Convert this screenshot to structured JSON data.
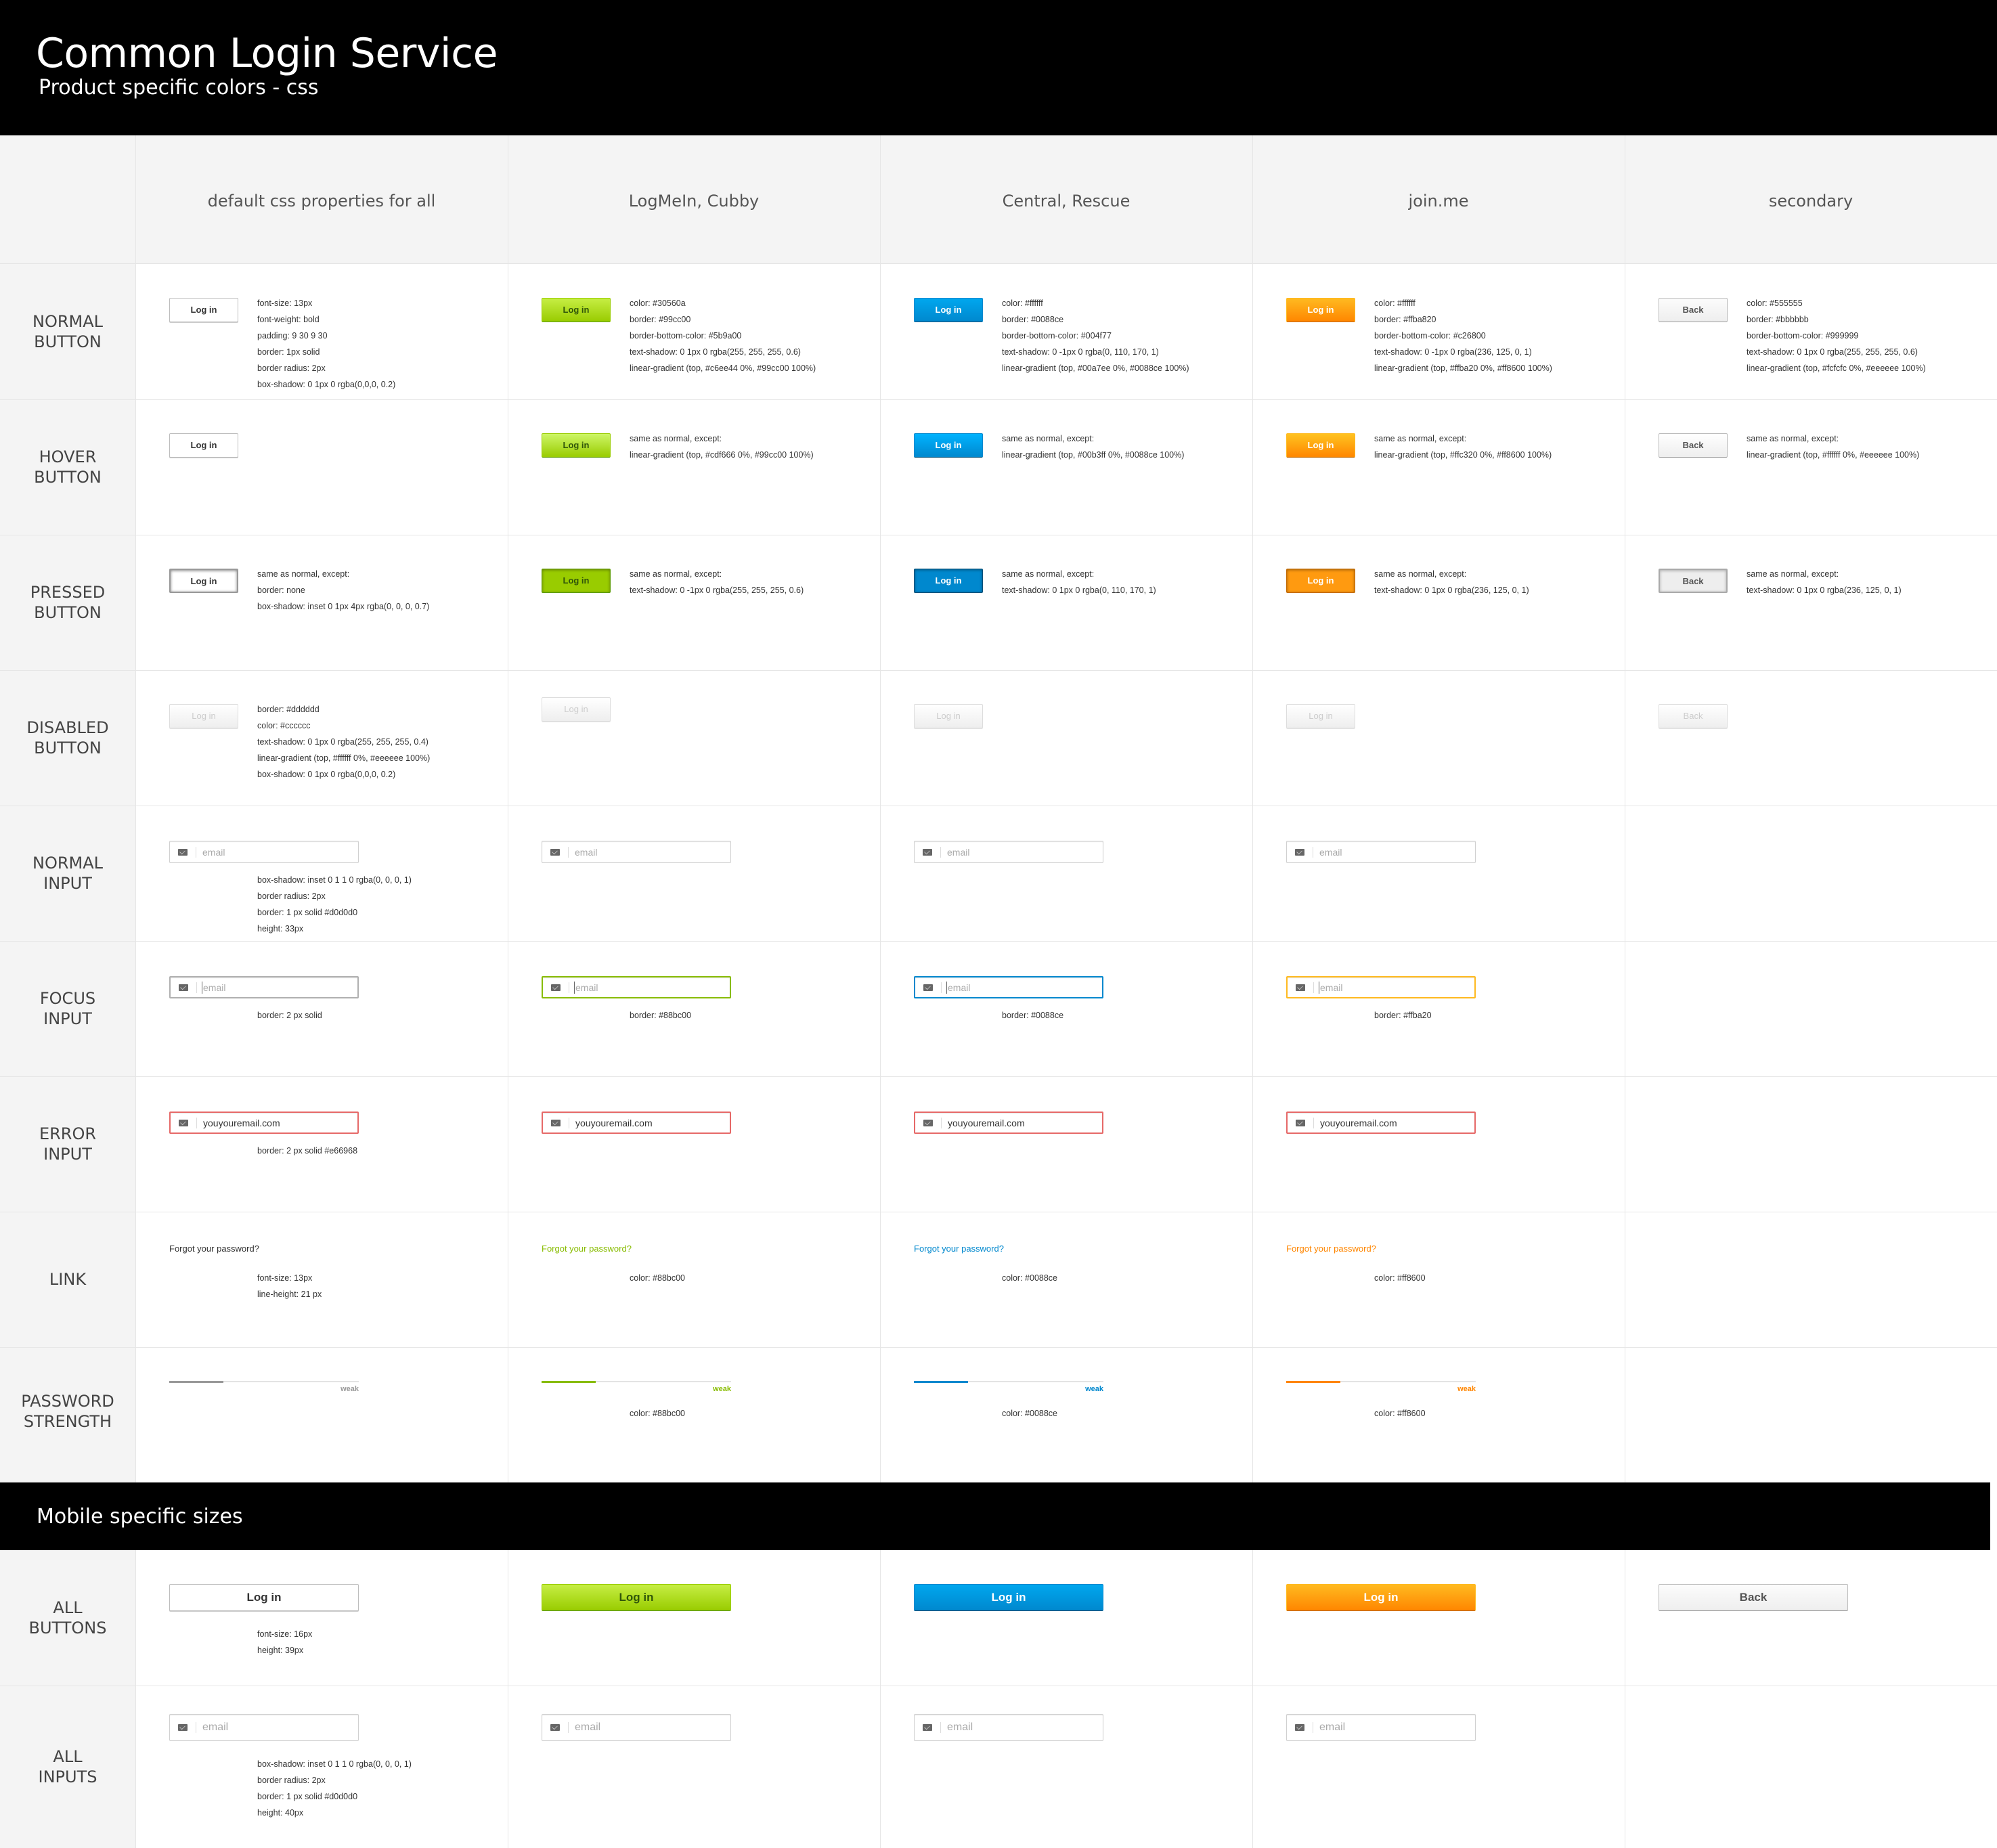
{
  "header": {
    "title": "Common Login Service",
    "subtitle": "Product specific colors - css"
  },
  "columns": [
    "default css properties for all",
    "LogMeIn, Cubby",
    "Central, Rescue",
    "join.me",
    "secondary"
  ],
  "rows": {
    "normal_button": [
      "NORMAL",
      "BUTTON"
    ],
    "hover_button": [
      "HOVER",
      "BUTTON"
    ],
    "pressed_button": [
      "PRESSED",
      "BUTTON"
    ],
    "disabled_button": [
      "DISABLED",
      "BUTTON"
    ],
    "normal_input": [
      "NORMAL",
      "INPUT"
    ],
    "focus_input": [
      "FOCUS",
      "INPUT"
    ],
    "error_input": [
      "ERROR",
      "INPUT"
    ],
    "link": [
      "LINK"
    ],
    "password_strength": [
      "PASSWORD",
      "STRENGTH"
    ],
    "all_buttons": [
      "ALL",
      "BUTTONS"
    ],
    "all_inputs": [
      "ALL",
      "INPUTS"
    ]
  },
  "labels": {
    "login": "Log in",
    "back": "Back",
    "email_placeholder": "email",
    "error_value": "youyouremail.com",
    "forgot": "Forgot your password?",
    "weak": "weak",
    "mobile_title": "Mobile specific sizes"
  },
  "colors": {
    "green": "#88bc00",
    "blue": "#0088ce",
    "orange": "#ff8600",
    "gray": "#999999",
    "error": "#e66968"
  },
  "notes": {
    "normal_default": [
      "font-size: 13px",
      "font-weight: bold",
      "padding: 9 30 9 30",
      "border: 1px solid",
      "border radius: 2px",
      "box-shadow: 0 1px 0 rgba(0,0,0, 0.2)"
    ],
    "normal_green": [
      "color: #30560a",
      "border: #99cc00",
      "border-bottom-color: #5b9a00",
      "text-shadow: 0 1px 0 rgba(255, 255, 255, 0.6)",
      "linear-gradient (top, #c6ee44 0%, #99cc00 100%)"
    ],
    "normal_blue": [
      "color: #ffffff",
      "border: #0088ce",
      "border-bottom-color: #004f77",
      "text-shadow: 0 -1px 0 rgba(0, 110, 170, 1)",
      "linear-gradient (top, #00a7ee 0%, #0088ce 100%)"
    ],
    "normal_orange": [
      "color: #ffffff",
      "border: #ffba820",
      "border-bottom-color: #c26800",
      "text-shadow: 0 -1px 0 rgba(236, 125, 0, 1)",
      "linear-gradient (top, #ffba20 0%, #ff8600 100%)"
    ],
    "normal_sec": [
      "color: #555555",
      "border: #bbbbbb",
      "border-bottom-color: #999999",
      "text-shadow: 0 1px 0 rgba(255, 255, 255, 0.6)",
      "linear-gradient (top, #fcfcfc 0%, #eeeeee 100%)"
    ],
    "hover_green": [
      "same as normal, except:",
      "linear-gradient (top, #cdf666 0%, #99cc00 100%)"
    ],
    "hover_blue": [
      "same as normal, except:",
      "linear-gradient (top, #00b3ff 0%, #0088ce 100%)"
    ],
    "hover_orange": [
      "same as normal, except:",
      "linear-gradient (top, #ffc320 0%, #ff8600 100%)"
    ],
    "hover_sec": [
      "same as normal, except:",
      "linear-gradient (top, #ffffff 0%, #eeeeee 100%)"
    ],
    "pressed_default": [
      "same as normal, except:",
      "border: none",
      "box-shadow: inset 0 1px 4px rgba(0, 0, 0, 0.7)"
    ],
    "pressed_green": [
      "same as normal, except:",
      "text-shadow: 0 -1px 0 rgba(255, 255, 255, 0.6)"
    ],
    "pressed_blue": [
      "same as normal, except:",
      "text-shadow: 0 1px 0 rgba(0, 110, 170, 1)"
    ],
    "pressed_orange": [
      "same as normal, except:",
      "text-shadow: 0 1px 0 rgba(236, 125, 0, 1)"
    ],
    "pressed_sec": [
      "same as normal, except:",
      "text-shadow: 0 1px 0 rgba(236, 125, 0, 1)"
    ],
    "disabled_default": [
      "border: #dddddd",
      "color: #cccccc",
      "text-shadow: 0 1px 0 rgba(255, 255, 255, 0.4)",
      "linear-gradient (top, #ffffff 0%, #eeeeee 100%)",
      "box-shadow: 0 1px 0 rgba(0,0,0, 0.2)"
    ],
    "input_default": [
      "box-shadow: inset 0  1  1  0 rgba(0, 0, 0, 1)",
      "border radius: 2px",
      "border: 1 px solid #d0d0d0",
      "height: 33px"
    ],
    "focus_default": [
      "border: 2 px solid"
    ],
    "focus_green": [
      "border: #88bc00"
    ],
    "focus_blue": [
      "border: #0088ce"
    ],
    "focus_orange": [
      "border: #ffba20"
    ],
    "error_default": [
      "border: 2 px solid #e66968"
    ],
    "link_default": [
      "font-size: 13px",
      "line-height: 21 px"
    ],
    "link_green": [
      "color: #88bc00"
    ],
    "link_blue": [
      "color: #0088ce"
    ],
    "link_orange": [
      "color: #ff8600"
    ],
    "strength_green": [
      "color: #88bc00"
    ],
    "strength_blue": [
      "color: #0088ce"
    ],
    "strength_orange": [
      "color: #ff8600"
    ],
    "all_buttons_default": [
      "font-size: 16px",
      "height: 39px"
    ],
    "all_inputs_default": [
      "box-shadow: inset 0  1  1  0 rgba(0, 0, 0, 1)",
      "border radius: 2px",
      "border: 1 px solid #d0d0d0",
      "height: 40px"
    ]
  }
}
